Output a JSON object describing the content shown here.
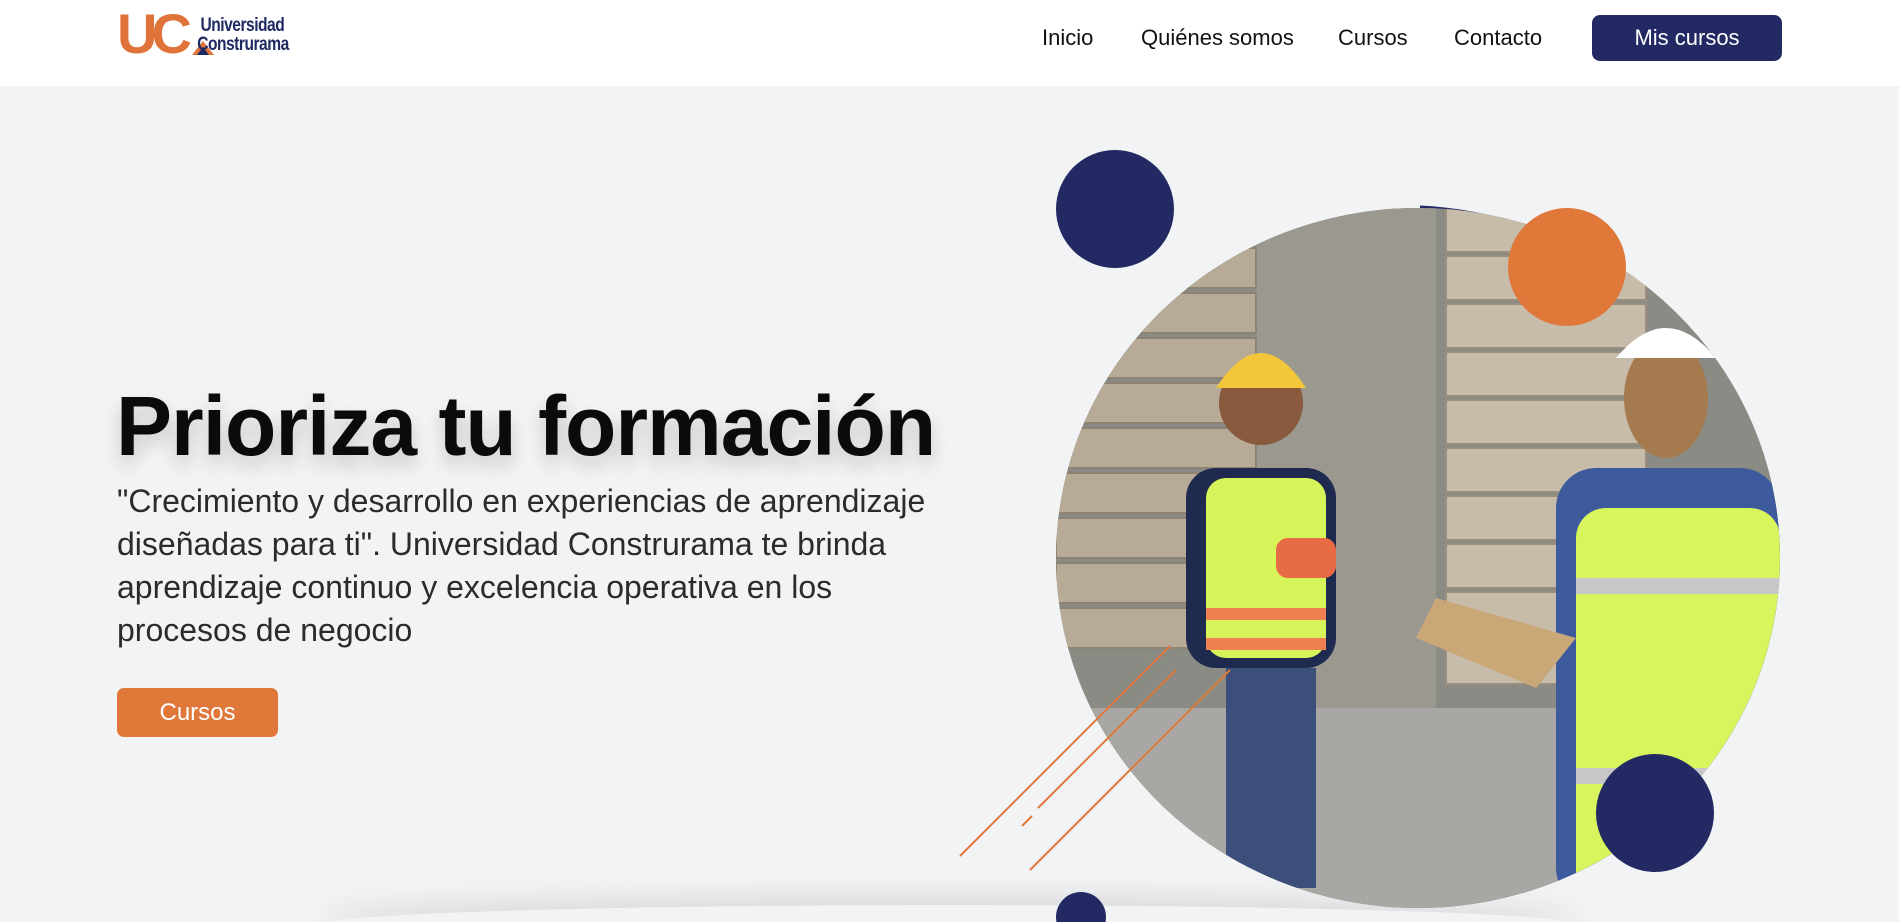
{
  "header": {
    "logo": {
      "mark": "UC",
      "line1": "Universidad",
      "line2": "Construrama"
    },
    "nav": [
      {
        "label": "Inicio"
      },
      {
        "label": "Quiénes somos"
      },
      {
        "label": "Cursos"
      },
      {
        "label": "Contacto"
      }
    ],
    "cta_label": "Mis cursos"
  },
  "hero": {
    "title": "Prioriza tu formación",
    "subtitle": "\"Crecimiento y desarrollo en experiencias de aprendizaje diseñadas para ti\". Universidad Construrama te brinda aprendizaje continuo y excelencia operativa en los procesos de negocio",
    "button_label": "Cursos"
  },
  "colors": {
    "navy": "#232a63",
    "orange": "#e0783a",
    "background": "#f2f3f5"
  },
  "icons": {
    "logo_mark": "construrama-house-icon"
  }
}
